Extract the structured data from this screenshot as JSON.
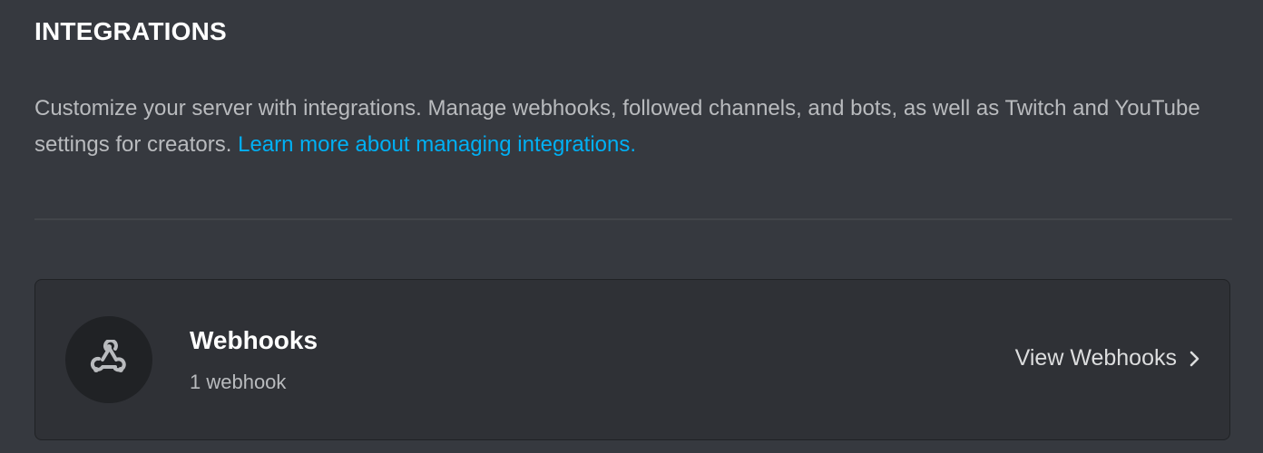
{
  "header": {
    "title": "INTEGRATIONS"
  },
  "description": {
    "text": "Customize your server with integrations. Manage webhooks, followed channels, and bots, as well as Twitch and YouTube settings for creators. ",
    "link_label": "Learn more about managing integrations."
  },
  "webhooks_card": {
    "icon": "webhook-icon",
    "title": "Webhooks",
    "subtitle": "1 webhook",
    "action_label": "View Webhooks",
    "action_icon": "chevron-right-icon"
  },
  "colors": {
    "background": "#36393f",
    "card_background": "#2f3136",
    "link": "#00b0f4",
    "heading": "#ffffff",
    "muted_text": "#b9bbbe"
  }
}
